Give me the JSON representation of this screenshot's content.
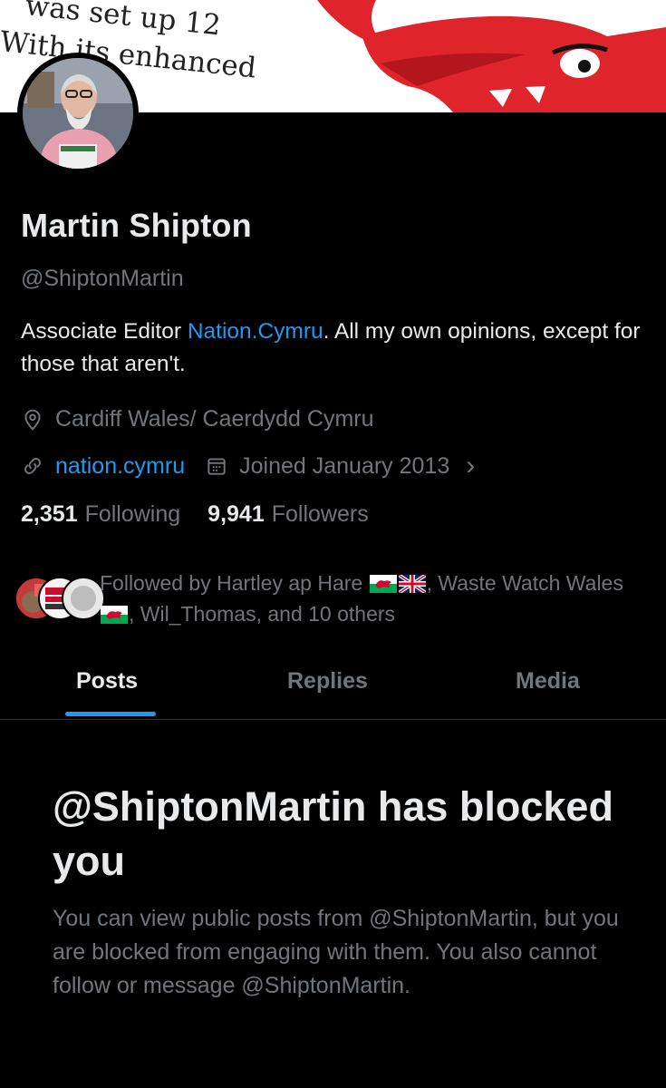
{
  "banner": {
    "line1": "was set up 12",
    "line2": "With its enhanced",
    "accent_color": "#e0242b"
  },
  "profile": {
    "avatar_alt": "profile photo",
    "name": "Martin Shipton",
    "handle": "@ShiptonMartin",
    "bio_prefix": "Associate Editor ",
    "bio_link": "Nation.Cymru",
    "bio_suffix": ". All my own opinions, except for those that aren't.",
    "location": "Cardiff Wales/ Caerdydd Cymru",
    "website": "nation.cymru",
    "joined": "Joined January 2013",
    "chevron": "›"
  },
  "counts": {
    "following_num": "2,351",
    "following_label": "Following",
    "followers_num": "9,941",
    "followers_label": "Followers"
  },
  "followed_by": {
    "part1": "Followed by Hartley ap Hare ",
    "part2": ", Waste Watch Wales ",
    "part3": ", Wil_Thomas, and 10 others"
  },
  "tabs": [
    {
      "label": "Posts",
      "active": true
    },
    {
      "label": "Replies",
      "active": false
    },
    {
      "label": "Media",
      "active": false
    }
  ],
  "blocked": {
    "title": "@ShiptonMartin has blocked you",
    "body": "You can view public posts from @ShiptonMartin, but you are blocked from engaging with them. You also cannot follow or message @ShiptonMartin."
  },
  "colors": {
    "background": "#000000",
    "text": "#e7e9ea",
    "muted": "#71767b",
    "accent": "#1d9bf0"
  }
}
